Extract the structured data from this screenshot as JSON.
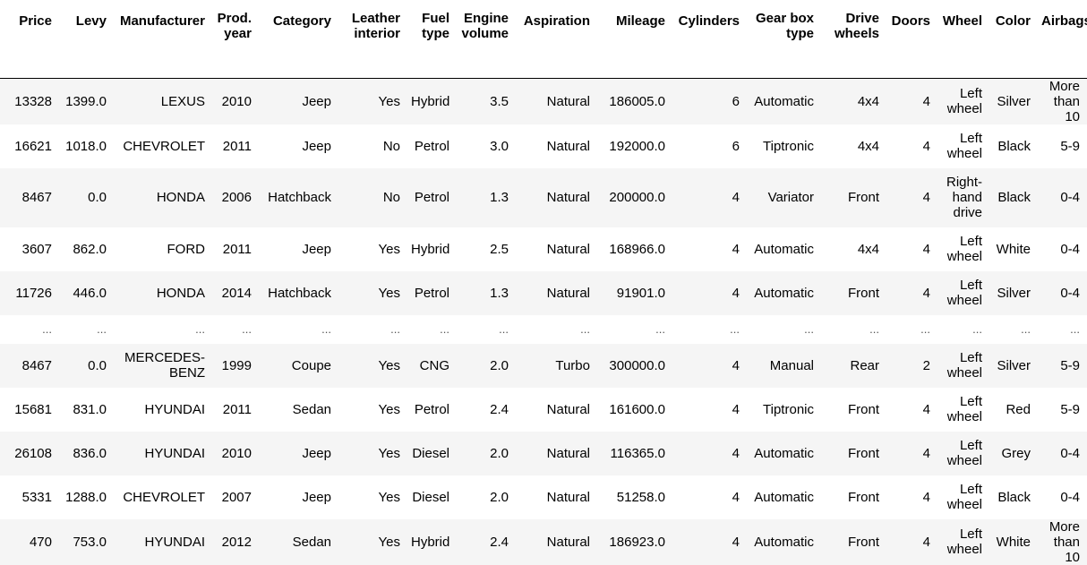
{
  "table": {
    "columns": [
      "Price",
      "Levy",
      "Manufacturer",
      "Prod. year",
      "Category",
      "Leather interior",
      "Fuel type",
      "Engine volume",
      "Aspiration",
      "Mileage",
      "Cylinders",
      "Gear box type",
      "Drive wheels",
      "Doors",
      "Wheel",
      "Color",
      "Airbags"
    ],
    "rows": [
      [
        "13328",
        "1399.0",
        "LEXUS",
        "2010",
        "Jeep",
        "Yes",
        "Hybrid",
        "3.5",
        "Natural",
        "186005.0",
        "6",
        "Automatic",
        "4x4",
        "4",
        "Left wheel",
        "Silver",
        "More than 10"
      ],
      [
        "16621",
        "1018.0",
        "CHEVROLET",
        "2011",
        "Jeep",
        "No",
        "Petrol",
        "3.0",
        "Natural",
        "192000.0",
        "6",
        "Tiptronic",
        "4x4",
        "4",
        "Left wheel",
        "Black",
        "5-9"
      ],
      [
        "8467",
        "0.0",
        "HONDA",
        "2006",
        "Hatchback",
        "No",
        "Petrol",
        "1.3",
        "Natural",
        "200000.0",
        "4",
        "Variator",
        "Front",
        "4",
        "Right-hand drive",
        "Black",
        "0-4"
      ],
      [
        "3607",
        "862.0",
        "FORD",
        "2011",
        "Jeep",
        "Yes",
        "Hybrid",
        "2.5",
        "Natural",
        "168966.0",
        "4",
        "Automatic",
        "4x4",
        "4",
        "Left wheel",
        "White",
        "0-4"
      ],
      [
        "11726",
        "446.0",
        "HONDA",
        "2014",
        "Hatchback",
        "Yes",
        "Petrol",
        "1.3",
        "Natural",
        "91901.0",
        "4",
        "Automatic",
        "Front",
        "4",
        "Left wheel",
        "Silver",
        "0-4"
      ],
      [
        "...",
        "...",
        "...",
        "...",
        "...",
        "...",
        "...",
        "...",
        "...",
        "...",
        "...",
        "...",
        "...",
        "...",
        "...",
        "...",
        "..."
      ],
      [
        "8467",
        "0.0",
        "MERCEDES-BENZ",
        "1999",
        "Coupe",
        "Yes",
        "CNG",
        "2.0",
        "Turbo",
        "300000.0",
        "4",
        "Manual",
        "Rear",
        "2",
        "Left wheel",
        "Silver",
        "5-9"
      ],
      [
        "15681",
        "831.0",
        "HYUNDAI",
        "2011",
        "Sedan",
        "Yes",
        "Petrol",
        "2.4",
        "Natural",
        "161600.0",
        "4",
        "Tiptronic",
        "Front",
        "4",
        "Left wheel",
        "Red",
        "5-9"
      ],
      [
        "26108",
        "836.0",
        "HYUNDAI",
        "2010",
        "Jeep",
        "Yes",
        "Diesel",
        "2.0",
        "Natural",
        "116365.0",
        "4",
        "Automatic",
        "Front",
        "4",
        "Left wheel",
        "Grey",
        "0-4"
      ],
      [
        "5331",
        "1288.0",
        "CHEVROLET",
        "2007",
        "Jeep",
        "Yes",
        "Diesel",
        "2.0",
        "Natural",
        "51258.0",
        "4",
        "Automatic",
        "Front",
        "4",
        "Left wheel",
        "Black",
        "0-4"
      ],
      [
        "470",
        "753.0",
        "HYUNDAI",
        "2012",
        "Sedan",
        "Yes",
        "Hybrid",
        "2.4",
        "Natural",
        "186923.0",
        "4",
        "Automatic",
        "Front",
        "4",
        "Left wheel",
        "White",
        "More than 10"
      ]
    ]
  }
}
